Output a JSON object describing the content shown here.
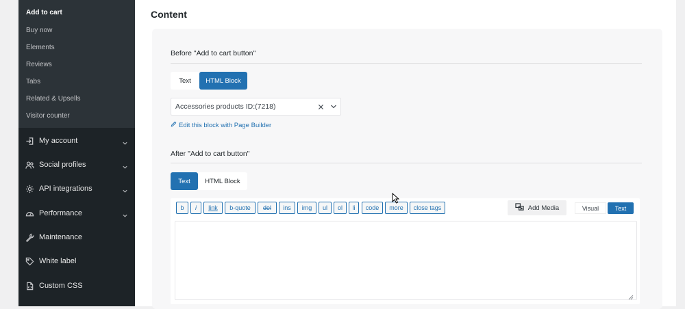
{
  "sidebar": {
    "subitems": [
      {
        "label": "Add to cart",
        "active": true
      },
      {
        "label": "Buy now"
      },
      {
        "label": "Elements"
      },
      {
        "label": "Reviews"
      },
      {
        "label": "Tabs"
      },
      {
        "label": "Related & Upsells"
      },
      {
        "label": "Visitor counter"
      }
    ],
    "items": [
      {
        "label": "My account",
        "icon": "sign-in-icon",
        "has_chevron": true
      },
      {
        "label": "Social profiles",
        "icon": "users-icon",
        "has_chevron": true
      },
      {
        "label": "API integrations",
        "icon": "gear-icon",
        "has_chevron": true
      },
      {
        "label": "Performance",
        "icon": "gauge-icon",
        "has_chevron": true
      },
      {
        "label": "Maintenance",
        "icon": "wrench-icon",
        "has_chevron": false
      },
      {
        "label": "White label",
        "icon": "tag-icon",
        "has_chevron": false
      },
      {
        "label": "Custom CSS",
        "icon": "file-code-icon",
        "has_chevron": false
      }
    ]
  },
  "main": {
    "heading": "Content",
    "before": {
      "label": "Before \"Add to cart button\"",
      "tabs": [
        {
          "label": "Text"
        },
        {
          "label": "HTML Block",
          "active": true
        }
      ],
      "select_value": "Accessories products ID:(7218)",
      "edit_link": "Edit this block with Page Builder"
    },
    "after": {
      "label": "After \"Add to cart button\"",
      "tabs": [
        {
          "label": "Text",
          "active": true
        },
        {
          "label": "HTML Block"
        }
      ]
    },
    "editor": {
      "buttons": [
        "b",
        "i",
        "link",
        "b-quote",
        "del",
        "ins",
        "img",
        "ul",
        "ol",
        "li",
        "code",
        "more",
        "close tags"
      ],
      "add_media": "Add Media",
      "mode_visual": "Visual",
      "mode_text": "Text",
      "active_mode": "Text",
      "content": ""
    }
  },
  "colors": {
    "sidebar_bg": "#1d2327",
    "submenu_bg": "#2c3338",
    "accent": "#2271b1",
    "panel_bg": "#f7f7f8"
  }
}
